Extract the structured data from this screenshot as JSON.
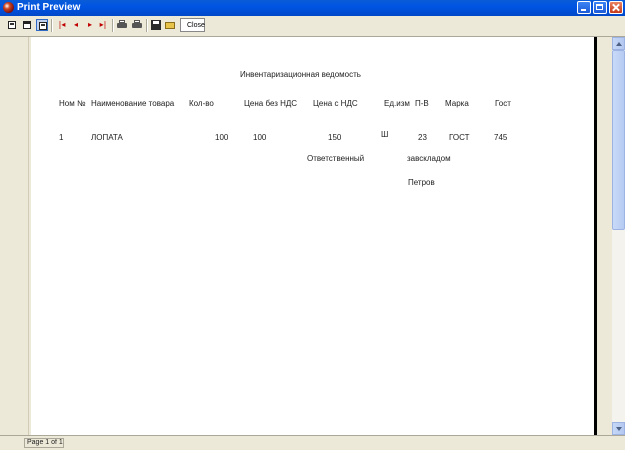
{
  "window": {
    "title": "Print Preview",
    "controls": {
      "minimize": "minimize-icon",
      "maximize": "maximize-icon",
      "close": "close-icon"
    }
  },
  "toolbar": {
    "icons": [
      "one-page-icon",
      "two-pages-icon",
      "zoom-icon",
      "first-page-icon",
      "prev-page-icon",
      "next-page-icon",
      "last-page-icon",
      "print-icon",
      "print-setup-icon",
      "save-icon",
      "open-icon"
    ],
    "nav_glyphs": {
      "first": "|◂",
      "prev": "◂",
      "next": "▸",
      "last": "▸|"
    },
    "close_label": "Close"
  },
  "report": {
    "title": "Инвентаризационная ведомость",
    "columns": [
      "Ном №",
      "Наименование товара",
      "Кол-во",
      "Цена без НДС",
      "Цена с НДС",
      "Ед.изм",
      "П-В",
      "Марка",
      "Гост"
    ],
    "rows": [
      {
        "num": "1",
        "name": "ЛОПАТА",
        "qty": "100",
        "price_no_vat": "100",
        "price_vat": "150",
        "unit": "Ш",
        "pv": "23",
        "brand": "ГОСТ",
        "gost": "745"
      }
    ],
    "footer": {
      "responsible_label": "Ответственный",
      "storekeeper_label": "завскладом",
      "storekeeper_name": "Петров"
    }
  },
  "status": {
    "page": "Page 1 of 1"
  },
  "colors": {
    "titlebar": "#0054e3",
    "nav_arrows": "#c00000",
    "page": "#ffffff",
    "frame": "#ece9d8"
  }
}
